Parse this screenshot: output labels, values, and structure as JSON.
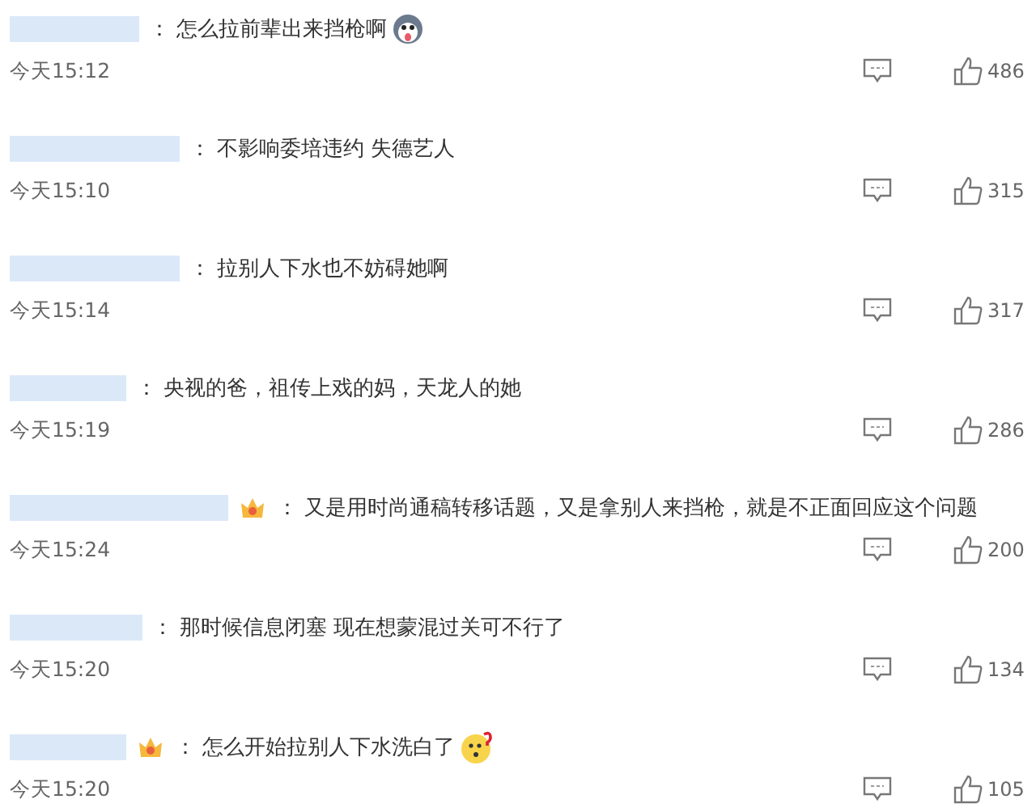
{
  "comments": [
    {
      "badge": false,
      "separator": "：",
      "text": "怎么拉前辈出来挡枪啊",
      "emoji": {
        "kind": "dog"
      },
      "time": "今天15:12",
      "likes": "486"
    },
    {
      "badge": false,
      "separator": "：",
      "text": "不影响委培违约 失德艺人",
      "time": "今天15:10",
      "likes": "315"
    },
    {
      "badge": false,
      "separator": "：",
      "text": "拉别人下水也不妨碍她啊",
      "time": "今天15:14",
      "likes": "317"
    },
    {
      "badge": false,
      "separator": "：",
      "text": "央视的爸，祖传上戏的妈，天龙人的她",
      "time": "今天15:19",
      "likes": "286"
    },
    {
      "badge": true,
      "separator": "：",
      "text": "又是用时尚通稿转移话题，又是拿别人来挡枪，就是不正面回应这个问题",
      "time": "今天15:24",
      "likes": "200"
    },
    {
      "badge": false,
      "separator": "：",
      "text": "那时候信息闭塞 现在想蒙混过关可不行了",
      "time": "今天15:20",
      "likes": "134"
    },
    {
      "badge": true,
      "separator": "：",
      "text": "怎么开始拉别人下水洗白了",
      "emoji": {
        "kind": "puzzled"
      },
      "time": "今天15:20",
      "likes": "105"
    }
  ]
}
